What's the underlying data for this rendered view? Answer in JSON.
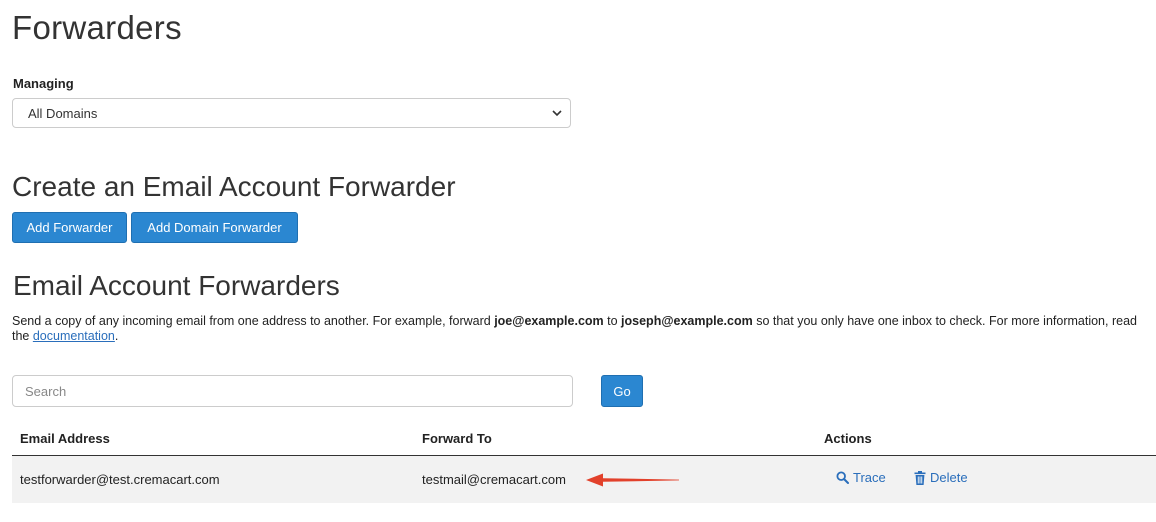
{
  "page": {
    "title": "Forwarders"
  },
  "managing": {
    "label": "Managing",
    "selected": "All Domains"
  },
  "create_section": {
    "title": "Create an Email Account Forwarder",
    "add_forwarder_label": "Add Forwarder",
    "add_domain_forwarder_label": "Add Domain Forwarder"
  },
  "forwarders_section": {
    "title": "Email Account Forwarders",
    "description": {
      "part1": "Send a copy of any incoming email from one address to another. For example, forward ",
      "example_from": "joe@example.com",
      "part2": " to ",
      "example_to": "joseph@example.com",
      "part3": " so that you only have one inbox to check. For more information, read the ",
      "link_text": "documentation",
      "part4": "."
    },
    "search": {
      "placeholder": "Search",
      "value": "",
      "go_label": "Go"
    },
    "table": {
      "headers": {
        "email": "Email Address",
        "forward": "Forward To",
        "actions": "Actions"
      },
      "rows": [
        {
          "email": "testforwarder@test.cremacart.com",
          "forward_to": "testmail@cremacart.com",
          "trace_label": "Trace",
          "delete_label": "Delete"
        }
      ]
    }
  },
  "colors": {
    "primary_button": "#2b87d1",
    "link": "#2a6ebb",
    "annotation_arrow": "#e2412b",
    "row_background": "#f2f2f2"
  },
  "icons": {
    "select": "chevron-down-icon",
    "trace": "search-icon",
    "delete": "trash-icon",
    "annotation": "red-arrow"
  }
}
